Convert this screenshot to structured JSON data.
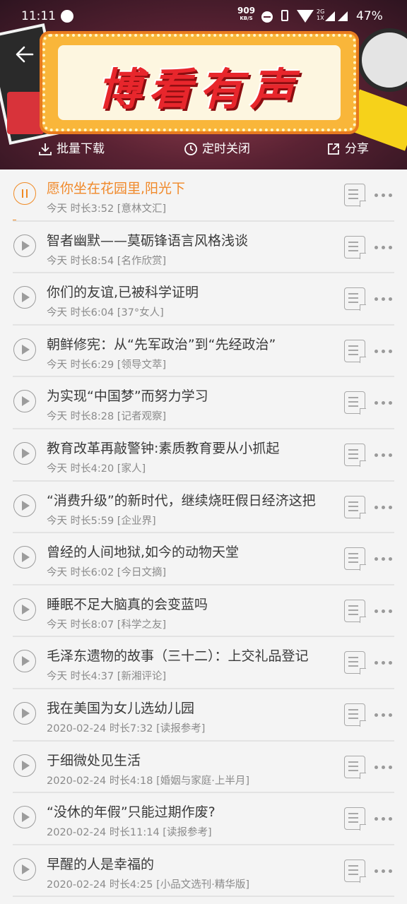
{
  "status_bar": {
    "time": "11:11",
    "speed": "909",
    "speed_unit": "KB/S",
    "network_a": "2G",
    "network_b": "1X",
    "battery": "47%"
  },
  "header": {
    "banner_text": "博看有声",
    "actions": [
      {
        "label": "批量下载",
        "icon": "download-icon"
      },
      {
        "label": "定时关闭",
        "icon": "clock-icon"
      },
      {
        "label": "分享",
        "icon": "share-icon"
      }
    ]
  },
  "colors": {
    "accent": "#f08a24",
    "text_primary": "#3a3a3a",
    "text_secondary": "#8a8a8a"
  },
  "playback": {
    "active_index": 0,
    "progress_fraction": 0.01
  },
  "list": {
    "items": [
      {
        "title": "愿你坐在花园里,阳光下",
        "date": "今天",
        "duration": "时长3:52",
        "source": "[意林文汇]"
      },
      {
        "title": "智者幽默——莫砺锋语言风格浅谈",
        "date": "今天",
        "duration": "时长8:54",
        "source": "[名作欣赏]"
      },
      {
        "title": "你们的友谊,已被科学证明",
        "date": "今天",
        "duration": "时长6:04",
        "source": "[37°女人]"
      },
      {
        "title": "朝鲜修宪：从“先军政治”到“先经政治”",
        "date": "今天",
        "duration": "时长6:29",
        "source": "[领导文萃]"
      },
      {
        "title": "为实现“中国梦”而努力学习",
        "date": "今天",
        "duration": "时长8:28",
        "source": "[记者观察]"
      },
      {
        "title": "教育改革再敲警钟:素质教育要从小抓起",
        "date": "今天",
        "duration": "时长4:20",
        "source": "[家人]"
      },
      {
        "title": "“消费升级”的新时代，继续烧旺假日经济这把",
        "date": "今天",
        "duration": "时长5:59",
        "source": "[企业界]"
      },
      {
        "title": "曾经的人间地狱,如今的动物天堂",
        "date": "今天",
        "duration": "时长6:02",
        "source": "[今日文摘]"
      },
      {
        "title": "睡眠不足大脑真的会变蓝吗",
        "date": "今天",
        "duration": "时长8:07",
        "source": "[科学之友]"
      },
      {
        "title": "毛泽东遗物的故事（三十二）：上交礼品登记",
        "date": "今天",
        "duration": "时长4:37",
        "source": "[新湘评论]"
      },
      {
        "title": "我在美国为女儿选幼儿园",
        "date": "2020-02-24",
        "duration": "时长7:32",
        "source": "[读报参考]"
      },
      {
        "title": "于细微处见生活",
        "date": "2020-02-24",
        "duration": "时长4:18",
        "source": "[婚姻与家庭·上半月]"
      },
      {
        "title": "“没休的年假”只能过期作废?",
        "date": "2020-02-24",
        "duration": "时长11:14",
        "source": "[读报参考]"
      },
      {
        "title": "早醒的人是幸福的",
        "date": "2020-02-24",
        "duration": "时长4:25",
        "source": "[小品文选刊·精华版]"
      }
    ]
  }
}
